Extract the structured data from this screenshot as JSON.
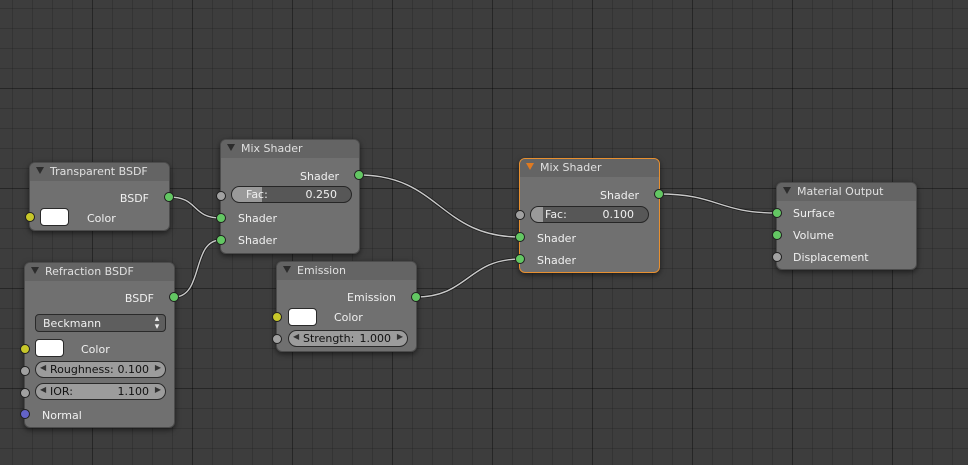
{
  "colors": {
    "link": "#c8c8c8",
    "socket_shader": "#63c763",
    "socket_color": "#c7c729",
    "socket_value": "#a1a1a1",
    "socket_vector": "#6363c7",
    "active_border": "#e89030"
  },
  "nodes": {
    "transparent_bsdf": {
      "title": "Transparent BSDF",
      "out_bsdf": "BSDF",
      "in_color": "Color",
      "color_value": "#ffffff"
    },
    "refraction_bsdf": {
      "title": "Refraction BSDF",
      "out_bsdf": "BSDF",
      "distribution": "Beckmann",
      "in_color": "Color",
      "color_value": "#ffffff",
      "roughness_label": "Roughness:",
      "roughness_value": "0.100",
      "ior_label": "IOR:",
      "ior_value": "1.100",
      "in_normal": "Normal"
    },
    "mix_shader_1": {
      "title": "Mix Shader",
      "out_shader": "Shader",
      "fac_label": "Fac:",
      "fac_value": "0.250",
      "fac_fraction": 0.25,
      "in_shader_1": "Shader",
      "in_shader_2": "Shader"
    },
    "emission": {
      "title": "Emission",
      "out_emission": "Emission",
      "in_color": "Color",
      "color_value": "#ffffff",
      "strength_label": "Strength:",
      "strength_value": "1.000"
    },
    "mix_shader_2": {
      "title": "Mix Shader",
      "out_shader": "Shader",
      "fac_label": "Fac:",
      "fac_value": "0.100",
      "fac_fraction": 0.1,
      "in_shader_1": "Shader",
      "in_shader_2": "Shader"
    },
    "material_output": {
      "title": "Material Output",
      "in_surface": "Surface",
      "in_volume": "Volume",
      "in_displacement": "Displacement"
    }
  }
}
